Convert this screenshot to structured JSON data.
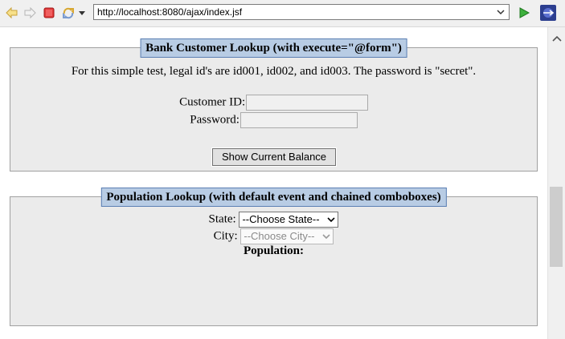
{
  "browser": {
    "url": "http://localhost:8080/ajax/index.jsf",
    "icons": [
      "back-arrow-icon",
      "forward-arrow-icon",
      "stop-icon",
      "refresh-icon",
      "menu-down-icon",
      "url-dropdown-icon",
      "go-icon",
      "eclipse-icon"
    ]
  },
  "bank": {
    "legend": "Bank Customer Lookup (with execute=\"@form\")",
    "instructions": "For this simple test, legal id's are id001, id002, and id003. The password is \"secret\".",
    "customer_id_label": "Customer ID:",
    "customer_id_value": "",
    "password_label": "Password:",
    "password_value": "",
    "button_label": "Show Current Balance"
  },
  "population": {
    "legend": "Population Lookup (with default event and chained comboboxes)",
    "state_label": "State:",
    "state_selected": "--Choose State--",
    "city_label": "City:",
    "city_selected": "--Choose City--",
    "population_label": "Population:"
  },
  "colors": {
    "legend_bg": "#b8cce4",
    "legend_border": "#5b7fb3",
    "fieldset_bg": "#ebebeb"
  }
}
